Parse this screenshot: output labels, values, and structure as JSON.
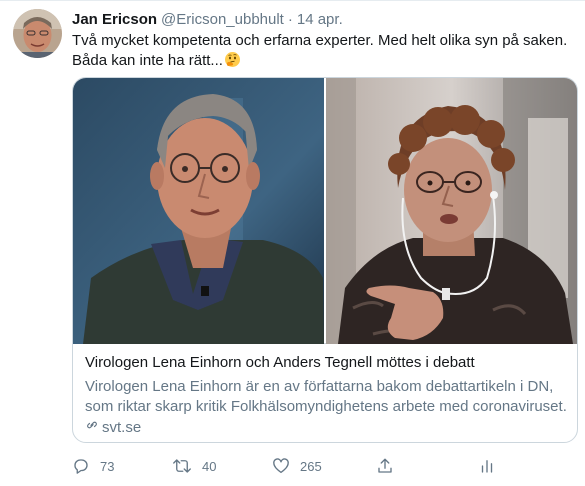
{
  "tweet": {
    "display_name": "Jan Ericson",
    "handle": "@Ericson_ubbhult",
    "separator": "·",
    "time": "14 apr.",
    "text": "Två mycket kompetenta och erfarna experter. Med helt olika syn på saken. Båda kan inte ha rätt...",
    "emoji": "thinking-face-emoji"
  },
  "card": {
    "title": "Virologen Lena Einhorn och Anders Tegnell möttes i debatt",
    "description": "Virologen Lena Einhorn är en av författarna bakom debattartikeln i DN, som riktar skarp kritik Folkhälsomyndighetens arbete med coronaviruset.",
    "domain": "svt.se",
    "link_icon": "link-icon"
  },
  "actions": {
    "reply": {
      "icon": "reply-icon",
      "count": "73"
    },
    "retweet": {
      "icon": "retweet-icon",
      "count": "40"
    },
    "like": {
      "icon": "heart-icon",
      "count": "265"
    },
    "share": {
      "icon": "share-icon"
    },
    "analytics": {
      "icon": "analytics-icon"
    }
  },
  "colors": {
    "text": "#14171a",
    "secondary": "#657786",
    "border": "#ccd6dd",
    "divider": "#e6ecf0"
  }
}
